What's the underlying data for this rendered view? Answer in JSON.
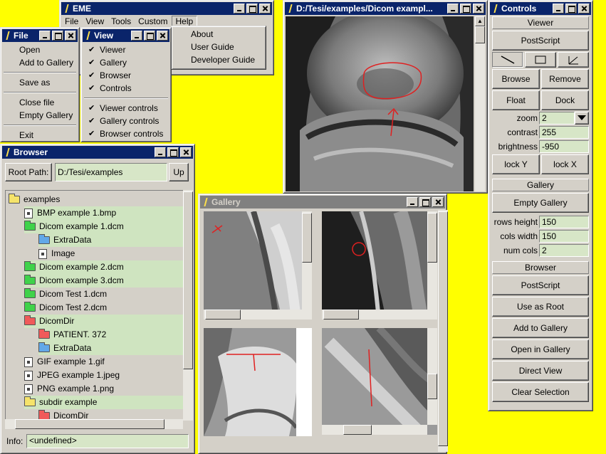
{
  "eme_window": {
    "title": "EME",
    "menus": [
      "File",
      "View",
      "Tools",
      "Custom",
      "Help"
    ]
  },
  "help_menu": {
    "items": [
      "About",
      "User Guide",
      "Developer Guide"
    ]
  },
  "file_window": {
    "title": "File",
    "items": [
      "Open",
      "Add to Gallery",
      "Save as",
      "Close file",
      "Empty Gallery",
      "Exit"
    ]
  },
  "view_window": {
    "title": "View",
    "items": [
      "Viewer",
      "Gallery",
      "Browser",
      "Controls",
      "Viewer controls",
      "Gallery controls",
      "Browser controls"
    ]
  },
  "viewer_window": {
    "title": "D:/Tesi/examples/Dicom exampl..."
  },
  "browser_window": {
    "title": "Browser",
    "root_label": "Root Path:",
    "root_value": "D:/Tesi/examples",
    "up_label": "Up",
    "info_label": "Info:",
    "info_value": "<undefined>",
    "tree": [
      {
        "label": "examples",
        "icon": "folder-yellow-open-icon"
      },
      {
        "label": "BMP example 1.bmp",
        "icon": "file-icon"
      },
      {
        "label": "Dicom example 1.dcm",
        "icon": "folder-green-open-icon"
      },
      {
        "label": "ExtraData",
        "icon": "folder-blue-icon"
      },
      {
        "label": "Image",
        "icon": "file-icon"
      },
      {
        "label": "Dicom example 2.dcm",
        "icon": "folder-green-icon"
      },
      {
        "label": "Dicom example 3.dcm",
        "icon": "folder-green-icon"
      },
      {
        "label": "Dicom Test 1.dcm",
        "icon": "folder-green-icon"
      },
      {
        "label": "Dicom Test 2.dcm",
        "icon": "folder-green-icon"
      },
      {
        "label": "DicomDir",
        "icon": "folder-red-open-icon"
      },
      {
        "label": "PATIENT. 372",
        "icon": "folder-red-icon"
      },
      {
        "label": "ExtraData",
        "icon": "folder-blue-icon"
      },
      {
        "label": "GIF example 1.gif",
        "icon": "file-icon"
      },
      {
        "label": "JPEG example 1.jpeg",
        "icon": "file-icon"
      },
      {
        "label": "PNG example 1.png",
        "icon": "file-icon"
      },
      {
        "label": "subdir example",
        "icon": "folder-yellow-open-icon"
      },
      {
        "label": "DicomDir",
        "icon": "folder-red-icon"
      }
    ]
  },
  "gallery_window": {
    "title": "Gallery"
  },
  "controls_window": {
    "title": "Controls",
    "viewer_section": "Viewer",
    "postscript": "PostScript",
    "browse": "Browse",
    "remove": "Remove",
    "float": "Float",
    "dock": "Dock",
    "zoom_label": "zoom",
    "zoom_value": "2",
    "contrast_label": "contrast",
    "contrast_value": "255",
    "brightness_label": "brightness",
    "brightness_value": "-950",
    "lock_y": "lock Y",
    "lock_x": "lock X",
    "gallery_section": "Gallery",
    "empty_gallery": "Empty Gallery",
    "rows_height_label": "rows height",
    "rows_height_value": "150",
    "cols_width_label": "cols width",
    "cols_width_value": "150",
    "num_cols_label": "num cols",
    "num_cols_value": "2",
    "browser_section": "Browser",
    "browser_postscript": "PostScript",
    "use_as_root": "Use as Root",
    "add_to_gallery": "Add to Gallery",
    "open_in_gallery": "Open in Gallery",
    "direct_view": "Direct View",
    "clear_selection": "Clear Selection"
  },
  "colors": {
    "desktop": "#FFFF00",
    "title_active": "#0a246a",
    "title_inactive": "#808080",
    "field_bg": "#d7e6c7",
    "roi_red": "#e02020"
  }
}
